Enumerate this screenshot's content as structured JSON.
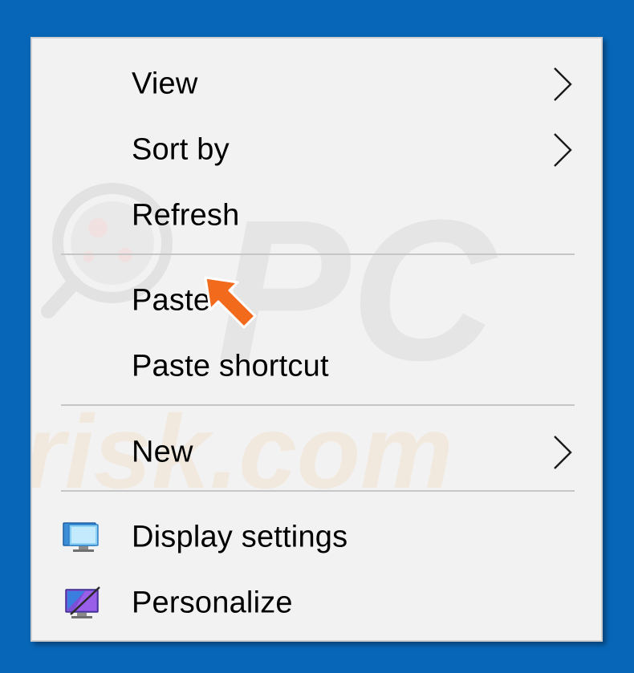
{
  "context_menu": {
    "items": [
      {
        "label": "View",
        "has_submenu": true
      },
      {
        "label": "Sort by",
        "has_submenu": true
      },
      {
        "label": "Refresh",
        "has_submenu": false
      },
      {
        "label": "Paste",
        "has_submenu": false
      },
      {
        "label": "Paste shortcut",
        "has_submenu": false
      },
      {
        "label": "New",
        "has_submenu": true
      },
      {
        "label": "Display settings",
        "icon": "display-icon"
      },
      {
        "label": "Personalize",
        "icon": "personalize-icon"
      }
    ]
  },
  "watermark": {
    "text_top": "PC",
    "text_bottom": "risk.com"
  },
  "colors": {
    "desktop_background": "#0866b8",
    "menu_background": "#f2f2f2",
    "separator": "#c6c6c6",
    "pointer_arrow": "#f26a1b"
  }
}
